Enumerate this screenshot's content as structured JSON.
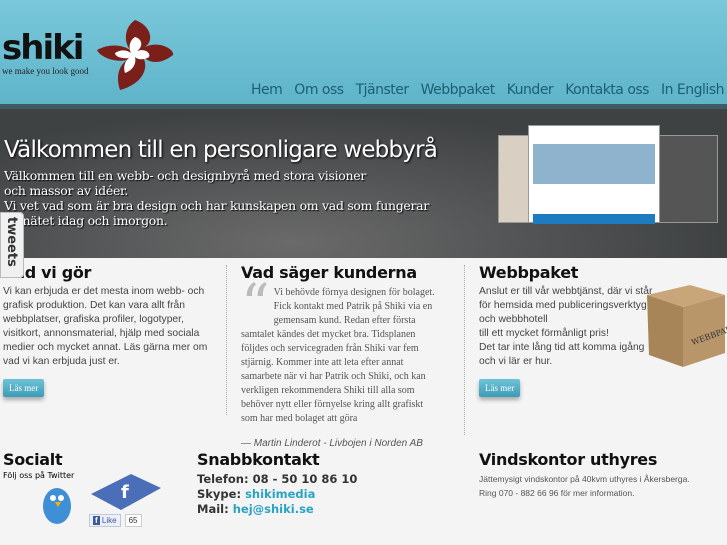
{
  "header": {
    "logo_text": "shiki",
    "tagline": "we make you look good",
    "nav": [
      "Hem",
      "Om oss",
      "Tjänster",
      "Webbpaket",
      "Kunder",
      "Kontakta oss",
      "In English"
    ]
  },
  "hero": {
    "title": "Välkommen till en personligare webbyrå",
    "lines": [
      "Välkommen till en webb- och designbyrå med stora visioner",
      "och massor av idéer.",
      "Vi vet vad som är bra design och har kunskapen om vad som fungerar",
      "på nätet idag och imorgon."
    ]
  },
  "tweets_tab": "tweets",
  "col1": {
    "title": "Vad vi gör",
    "text": "Vi kan erbjuda er det mesta inom webb- och grafisk produktion. Det kan vara allt från webbplatser, grafiska profiler, logotyper, visitkort, annonsmaterial, hjälp med sociala medier och mycket annat. Läs gärna mer om vad vi kan erbjuda just er.",
    "button": "Läs mer"
  },
  "col2": {
    "title": "Vad säger kunderna",
    "quote": "Vi behövde förnya designen för bolaget. Fick kontakt med Patrik på Shiki via en gemensam kund. Redan efter första samtalet kändes det mycket bra. Tidsplanen följdes och servicegraden från Shiki var fem stjärnig. Kommer inte att leta efter annat samarbete när vi har Patrik och Shiki, och kan verkligen rekommendera Shiki till alla som behöver nytt eller förnyelse kring allt grafiskt som har med bolaget att göra",
    "author": "— Martin Linderot - Livbojen i Norden AB"
  },
  "col3": {
    "title": "Webbpaket",
    "lines": [
      "Anslut er till vår webbtjänst, där vi står",
      "för hemsida med publiceringsverktyg",
      "och webbhotell",
      "till ett mycket förmånligt pris!",
      "Det tar inte lång tid att komma igång",
      "och vi lär er hur."
    ],
    "box_label": "WEBBPAKET",
    "button": "Läs mer"
  },
  "social": {
    "title": "Socialt",
    "twitter_label": "Följ oss på Twitter",
    "like_label": "Like",
    "like_count": "65"
  },
  "contact": {
    "title": "Snabbkontakt",
    "phone_label": "Telefon:",
    "phone": "08 - 50 10 86 10",
    "skype_label": "Skype:",
    "skype": "shikimedia",
    "mail_label": "Mail:",
    "mail": "hej@shiki.se"
  },
  "office": {
    "title": "Vindskontor uthyres",
    "lines": [
      "Jättemysigt vindskontor på 40kvm uthyres i Åkersberga.",
      "Ring 070 - 882 66 96 för mer information."
    ]
  }
}
